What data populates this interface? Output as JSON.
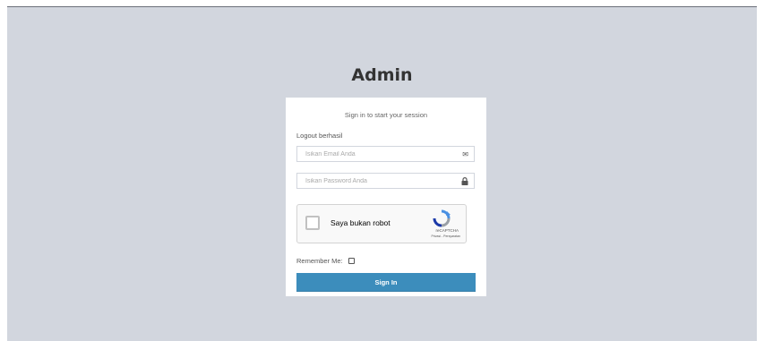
{
  "page": {
    "title": "Admin"
  },
  "login_box": {
    "subtitle": "Sign in to start your session",
    "message": "Logout berhasil",
    "email": {
      "placeholder": "Isikan Email Anda",
      "icon": "envelope-icon"
    },
    "password": {
      "placeholder": "Isikan Password Anda",
      "icon": "lock-icon"
    },
    "remember_label": "Remember Me:",
    "signin_label": "Sign In"
  },
  "captcha": {
    "label": "Saya bukan robot",
    "brand": "reCAPTCHA",
    "links": "Privasi - Persyaratan"
  },
  "colors": {
    "page_background": "#d2d6de",
    "primary_button": "#3c8dbc"
  }
}
